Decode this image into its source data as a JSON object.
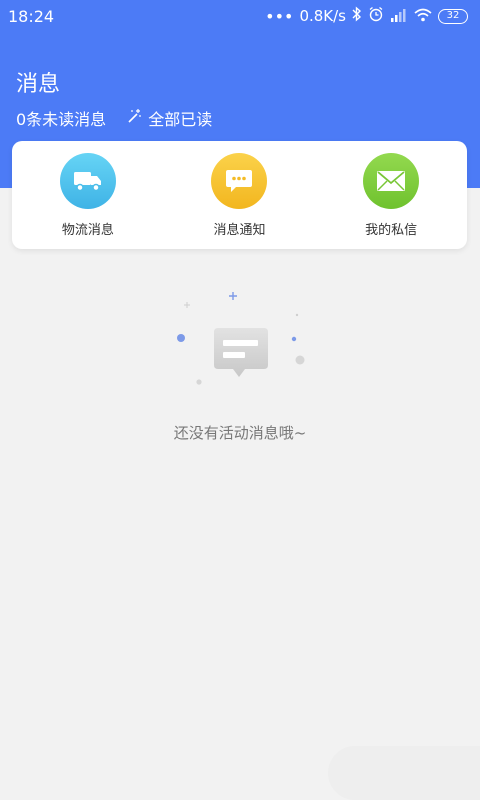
{
  "status_bar": {
    "time": "18:24",
    "dots": "•••",
    "speed": "0.8K/s",
    "battery": "32",
    "icons": [
      "bluetooth-icon",
      "alarm-icon",
      "signal-icon",
      "wifi-icon",
      "battery-icon"
    ]
  },
  "header": {
    "title": "消息",
    "unread": "0条未读消息",
    "mark_all_read": "全部已读",
    "bg_color": "#4c7bf6"
  },
  "categories": [
    {
      "label": "物流消息",
      "icon": "truck-icon",
      "color": "#55c7ee"
    },
    {
      "label": "消息通知",
      "icon": "chat-bubble-icon",
      "color": "#f7c236"
    },
    {
      "label": "我的私信",
      "icon": "envelope-icon",
      "color": "#82cf3e"
    }
  ],
  "empty_state": {
    "icon": "empty-message-icon",
    "text": "还没有活动消息哦~"
  }
}
